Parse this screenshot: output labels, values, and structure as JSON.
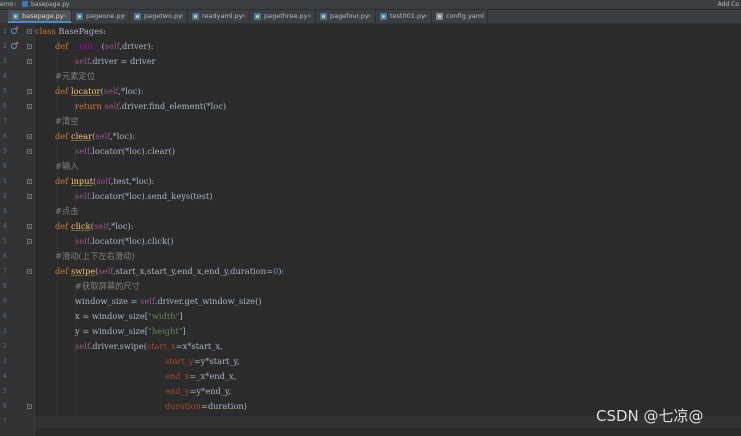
{
  "breadcrumb": {
    "project": "emo",
    "file": "basepage.py",
    "right_action": "Add Co"
  },
  "tabs": [
    {
      "label": "basepage.py",
      "active": true
    },
    {
      "label": "pageone.py"
    },
    {
      "label": "pagetwo.py"
    },
    {
      "label": "readyaml.py"
    },
    {
      "label": "pagethree.py"
    },
    {
      "label": "pagefour.py"
    },
    {
      "label": "test001.py"
    },
    {
      "label": "config.yaml"
    }
  ],
  "line_numbers": [
    "1",
    "2",
    "3",
    "4",
    "5",
    "6",
    "7",
    "8",
    "9",
    "0",
    "1",
    "2",
    "3",
    "4",
    "5",
    "6",
    "7",
    "8",
    "9",
    "0",
    "1",
    "2",
    "3",
    "4",
    "5",
    "6",
    "7"
  ],
  "code": {
    "l1_kw": "class",
    "l1_name": " BasePages:",
    "l2_def": "def",
    "l2_fn": "__init__",
    "l2_open": "(",
    "l2_self": "self",
    "l2_rest": ",driver):",
    "l3_self": "self",
    "l3_rest": ".driver = driver",
    "l4_cmt": "#元素定位",
    "l5_def": "def",
    "l5_fn": "locator",
    "l5_open": "(",
    "l5_self": "self",
    "l5_rest": ",*loc):",
    "l6_kw": "return",
    "l6_self": "self",
    "l6_rest": ".driver.find_element(*loc)",
    "l7_cmt": "#清空",
    "l8_def": "def",
    "l8_fn": "clear",
    "l8_open": "(",
    "l8_self": "self",
    "l8_rest": ",*loc):",
    "l9_self": "self",
    "l9_rest": ".locator(*loc).clear()",
    "l10_cmt": "#输入",
    "l11_def": "def",
    "l11_fn": "input",
    "l11_open": "(",
    "l11_self": "self",
    "l11_rest": ",test,*loc):",
    "l12_self": "self",
    "l12_rest": ".locator(*loc).send_keys(test)",
    "l13_cmt": "#点击",
    "l14_def": "def",
    "l14_fn": "click",
    "l14_open": "(",
    "l14_self": "self",
    "l14_rest": ",*loc):",
    "l15_self": "self",
    "l15_rest": ".locator(*loc).click()",
    "l16_cmt": "#滑动(上下左右滑动)",
    "l17_def": "def",
    "l17_fn": "swipe",
    "l17_open": "(",
    "l17_self": "self",
    "l17_rest": ",start_x,start_y,end_x,end_y,duration=",
    "l17_num": "0",
    "l17_close": "):",
    "l18_cmt": "#获取屏幕的尺寸",
    "l19_pre": "window_size = ",
    "l19_self": "self",
    "l19_rest": ".driver.get_window_size()",
    "l20_pre": "x = window_size[",
    "l20_str": "\"width\"",
    "l20_post": "]",
    "l21_pre": "y = window_size[",
    "l21_str": "\"height\"",
    "l21_post": "]",
    "l22_self": "self",
    "l22_rest": ".driver.swipe(",
    "l22_param": "start_x",
    "l22_post": "=x*start_x,",
    "l23_param": "start_y",
    "l23_post": "=y*start_y,",
    "l24_param": "end_x",
    "l24_post": "=_x*end_x,",
    "l25_param": "end_y",
    "l25_post": "=y*end_y,",
    "l26_param": "duration",
    "l26_post": "=duration)"
  },
  "watermark": "CSDN @七凉@"
}
